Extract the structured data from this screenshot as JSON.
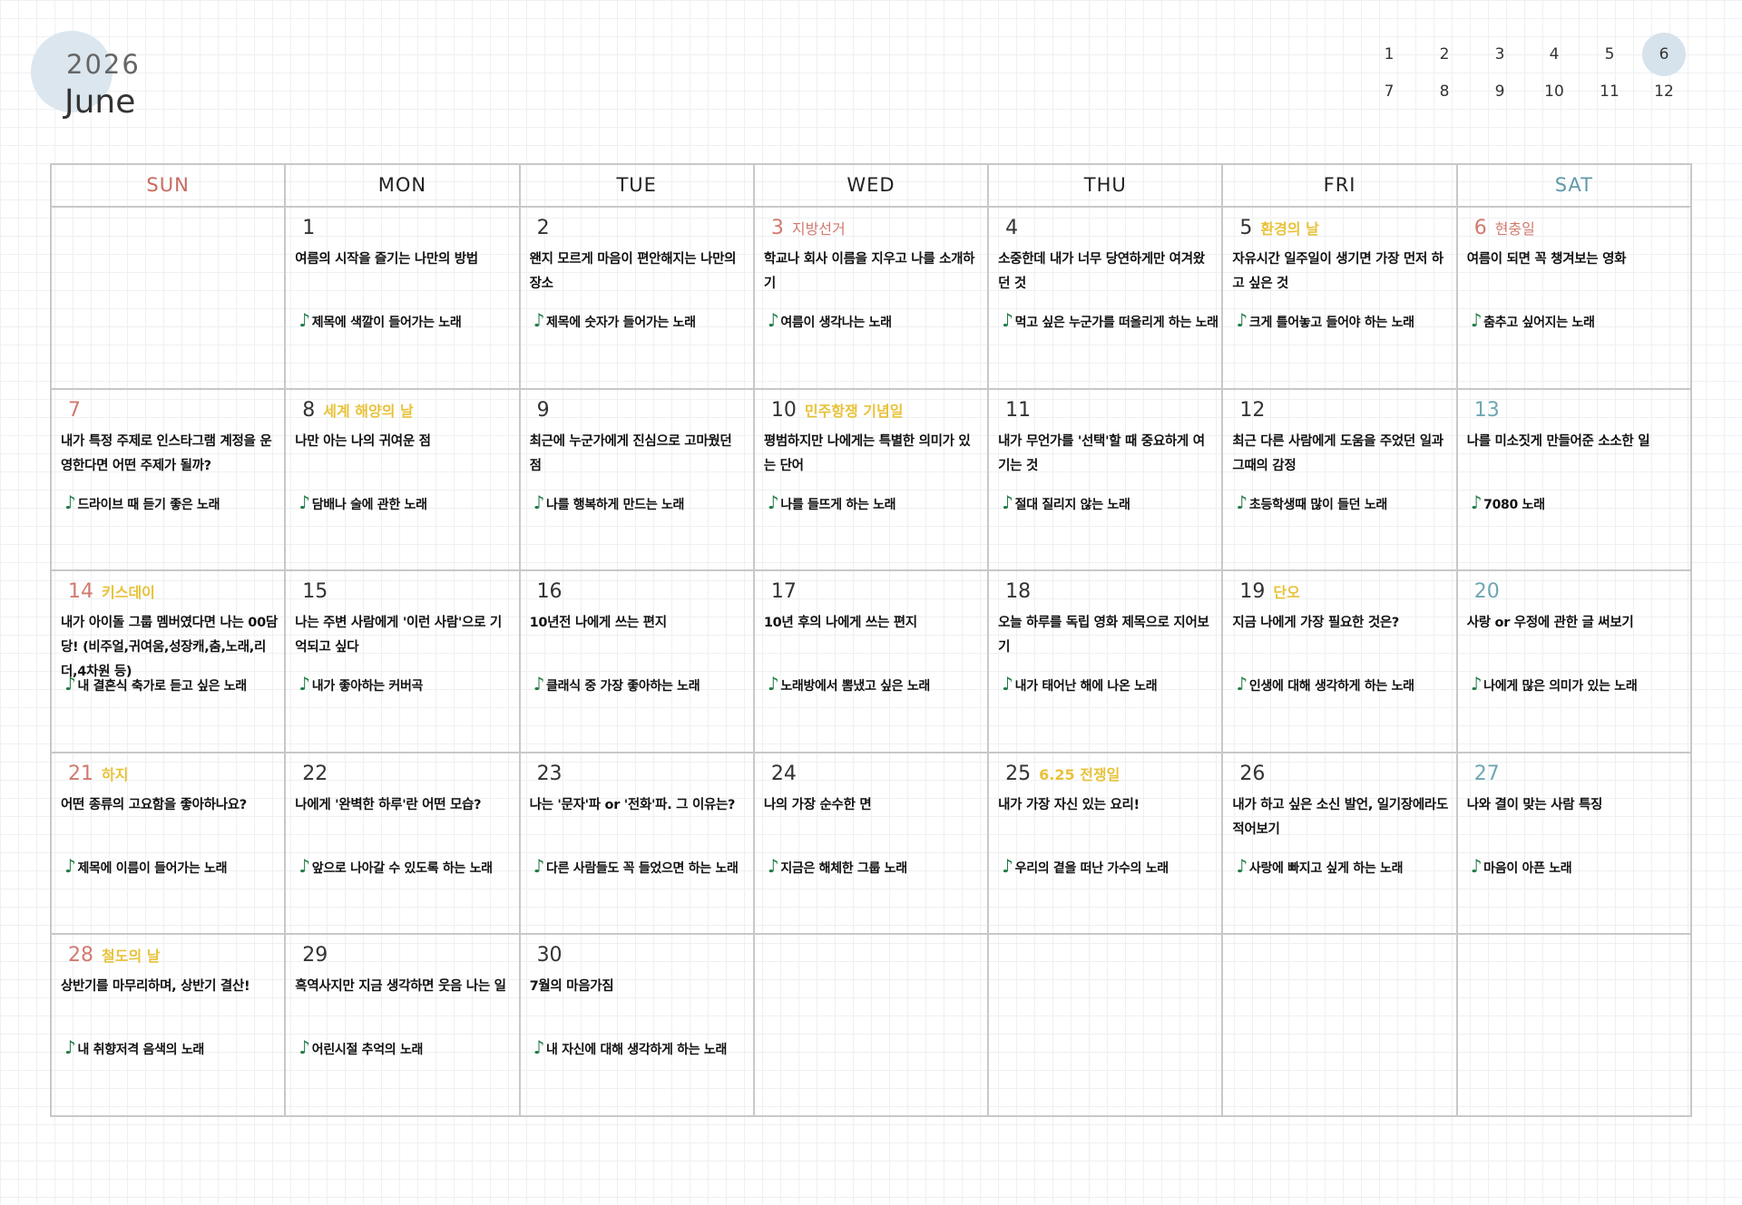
{
  "header": {
    "year": "2026",
    "month": "June"
  },
  "month_nav": {
    "active": "6",
    "rows": [
      [
        "1",
        "2",
        "3",
        "4",
        "5",
        "6"
      ],
      [
        "7",
        "8",
        "9",
        "10",
        "11",
        "12"
      ]
    ]
  },
  "colors": {
    "accent_circle": "#dbe6ee",
    "sunday": "#c96a60",
    "saturday": "#5f9aa8",
    "holiday_yellow": "#e8c23a",
    "note_green": "#1f7a45"
  },
  "weekdays": [
    "SUN",
    "MON",
    "TUE",
    "WED",
    "THU",
    "FRI",
    "SAT"
  ],
  "weeks": [
    [
      null,
      {
        "day": "1",
        "holiday": "",
        "prompt": "여름의 시작을 즐기는 나만의 방법",
        "song": "제목에 색깔이 들어가는 노래"
      },
      {
        "day": "2",
        "holiday": "",
        "prompt": "왠지 모르게 마음이 편안해지는 나만의 장소",
        "song": "제목에 숫자가 들어가는 노래"
      },
      {
        "day": "3",
        "holiday": "지방선거",
        "prompt": "학교나 회사 이름을 지우고 나를 소개하기",
        "song": "여름이 생각나는 노래",
        "num_color": "red",
        "holiday_color": "red"
      },
      {
        "day": "4",
        "holiday": "",
        "prompt": "소중한데 내가 너무 당연하게만 여겨왔던 것",
        "song": "먹고 싶은 누군가를 떠올리게 하는 노래"
      },
      {
        "day": "5",
        "holiday": "환경의 날",
        "prompt": "자유시간 일주일이 생기면 가장 먼저 하고 싶은 것",
        "song": "크게 틀어놓고 들어야 하는 노래",
        "holiday_color": "yellow"
      },
      {
        "day": "6",
        "holiday": "현충일",
        "prompt": "여름이 되면 꼭 챙겨보는 영화",
        "song": "춤추고 싶어지는 노래",
        "num_color": "red",
        "holiday_color": "red"
      }
    ],
    [
      {
        "day": "7",
        "holiday": "",
        "prompt": "내가 특정 주제로 인스타그램 계정을 운영한다면 어떤 주제가 될까?",
        "song": "드라이브 때 듣기 좋은 노래",
        "num_color": "red"
      },
      {
        "day": "8",
        "holiday": "세계 해양의 날",
        "prompt": "나만 아는 나의 귀여운 점",
        "song": "담배나 술에 관한 노래",
        "holiday_color": "yellow"
      },
      {
        "day": "9",
        "holiday": "",
        "prompt": "최근에 누군가에게 진심으로 고마웠던 점",
        "song": "나를 행복하게 만드는 노래"
      },
      {
        "day": "10",
        "holiday": "민주항쟁 기념일",
        "prompt": "평범하지만 나에게는 특별한 의미가 있는 단어",
        "song": "나를 들뜨게 하는 노래",
        "holiday_color": "yellow"
      },
      {
        "day": "11",
        "holiday": "",
        "prompt": "내가 무언가를 '선택'할 때 중요하게 여기는 것",
        "song": "절대 질리지 않는 노래"
      },
      {
        "day": "12",
        "holiday": "",
        "prompt": "최근 다른 사람에게 도움을 주었던 일과 그때의 감정",
        "song": "초등학생때 많이 들던 노래"
      },
      {
        "day": "13",
        "holiday": "",
        "prompt": "나를 미소짓게 만들어준 소소한 일",
        "song": "7080 노래",
        "num_color": "teal"
      }
    ],
    [
      {
        "day": "14",
        "holiday": "키스데이",
        "prompt": "내가 아이돌 그룹 멤버였다면 나는 00담당! (비주얼,귀여움,성장캐,춤,노래,리더,4차원 등)",
        "song": "내 결혼식 축가로 듣고 싶은 노래",
        "num_color": "red",
        "holiday_color": "yellow"
      },
      {
        "day": "15",
        "holiday": "",
        "prompt": "나는 주변 사람에게 '이런 사람'으로 기억되고 싶다",
        "song": "내가 좋아하는 커버곡"
      },
      {
        "day": "16",
        "holiday": "",
        "prompt": "10년전 나에게 쓰는 편지",
        "song": "클래식 중 가장 좋아하는 노래"
      },
      {
        "day": "17",
        "holiday": "",
        "prompt": "10년 후의 나에게 쓰는 편지",
        "song": "노래방에서 뽐냈고 싶은 노래"
      },
      {
        "day": "18",
        "holiday": "",
        "prompt": "오늘 하루를 독립 영화 제목으로 지어보기",
        "song": "내가 태어난 해에 나온 노래"
      },
      {
        "day": "19",
        "holiday": "단오",
        "prompt": "지금 나에게 가장 필요한 것은?",
        "song": "인생에 대해 생각하게 하는 노래",
        "holiday_color": "yellow"
      },
      {
        "day": "20",
        "holiday": "",
        "prompt": "사랑 or 우정에 관한 글 써보기",
        "song": "나에게 많은 의미가 있는 노래",
        "num_color": "teal"
      }
    ],
    [
      {
        "day": "21",
        "holiday": "하지",
        "prompt": "어떤 종류의 고요함을 좋아하나요?",
        "song": "제목에 이름이 들어가는 노래",
        "num_color": "red",
        "holiday_color": "yellow"
      },
      {
        "day": "22",
        "holiday": "",
        "prompt": "나에게 '완벽한 하루'란 어떤 모습?",
        "song": "앞으로 나아갈 수 있도록 하는 노래"
      },
      {
        "day": "23",
        "holiday": "",
        "prompt": "나는 '문자'파 or '전화'파. 그 이유는?",
        "song": "다른 사람들도 꼭 들었으면 하는 노래"
      },
      {
        "day": "24",
        "holiday": "",
        "prompt": "나의 가장 순수한 면",
        "song": "지금은 해체한 그룹 노래"
      },
      {
        "day": "25",
        "holiday": "6.25 전쟁일",
        "prompt": "내가 가장 자신 있는 요리!",
        "song": "우리의 곁을 떠난 가수의 노래",
        "holiday_color": "yellow"
      },
      {
        "day": "26",
        "holiday": "",
        "prompt": "내가 하고 싶은 소신 발언, 일기장에라도 적어보기",
        "song": "사랑에 빠지고 싶게 하는 노래"
      },
      {
        "day": "27",
        "holiday": "",
        "prompt": "나와 결이 맞는 사람 특징",
        "song": "마음이 아픈 노래",
        "num_color": "teal"
      }
    ],
    [
      {
        "day": "28",
        "holiday": "철도의 날",
        "prompt": "상반기를 마무리하며, 상반기 결산!",
        "song": "내 취향저격 음색의 노래",
        "num_color": "red",
        "holiday_color": "yellow"
      },
      {
        "day": "29",
        "holiday": "",
        "prompt": "흑역사지만 지금 생각하면 웃음 나는 일",
        "song": "어린시절 추억의 노래"
      },
      {
        "day": "30",
        "holiday": "",
        "prompt": "7월의 마음가짐",
        "song": "내 자신에 대해 생각하게 하는 노래"
      },
      null,
      null,
      null,
      null
    ]
  ]
}
